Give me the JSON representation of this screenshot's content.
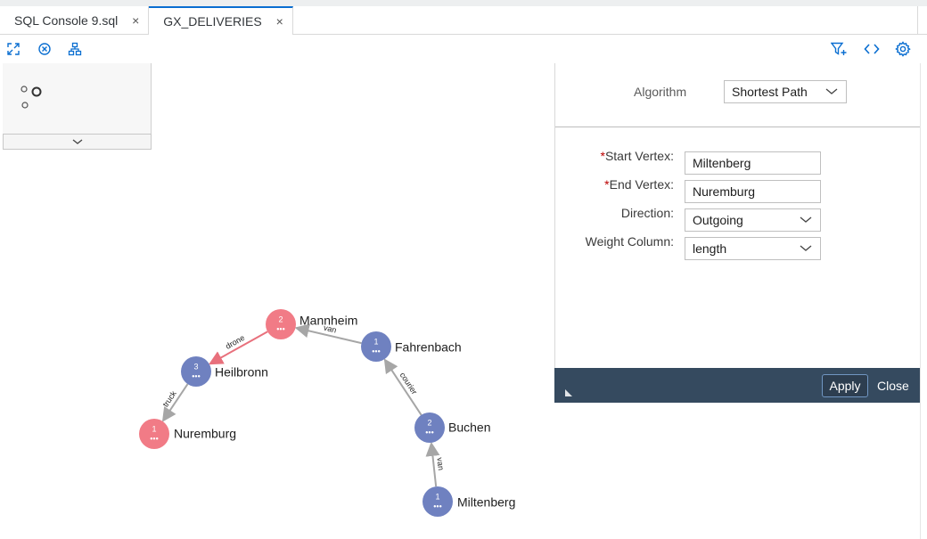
{
  "tabs": [
    {
      "label": "SQL Console 9.sql",
      "close": "×",
      "active": false
    },
    {
      "label": "GX_DELIVERIES",
      "close": "×",
      "active": true
    }
  ],
  "toolbar": {
    "left_icons": [
      "expand-icon",
      "clear-icon",
      "hierarchy-icon"
    ],
    "right_icons": [
      "filter-add-icon",
      "code-icon",
      "settings-icon"
    ]
  },
  "graph": {
    "vertices": [
      {
        "name": "Mannheim",
        "count": "2",
        "color": "#f17b86",
        "highlighted": true
      },
      {
        "name": "Fahrenbach",
        "count": "1",
        "color": "#6f81c0",
        "highlighted": false
      },
      {
        "name": "Heilbronn",
        "count": "3",
        "color": "#6f81c0",
        "highlighted": false
      },
      {
        "name": "Nuremburg",
        "count": "1",
        "color": "#f17b86",
        "highlighted": true
      },
      {
        "name": "Buchen",
        "count": "2",
        "color": "#6f81c0",
        "highlighted": false
      },
      {
        "name": "Miltenberg",
        "count": "1",
        "color": "#6f81c0",
        "highlighted": false
      }
    ],
    "edges": [
      {
        "from": "Fahrenbach",
        "to": "Mannheim",
        "label": "van",
        "highlighted": false
      },
      {
        "from": "Mannheim",
        "to": "Heilbronn",
        "label": "drone",
        "highlighted": true
      },
      {
        "from": "Heilbronn",
        "to": "Nuremburg",
        "label": "truck",
        "highlighted": false
      },
      {
        "from": "Buchen",
        "to": "Fahrenbach",
        "label": "courier",
        "highlighted": false
      },
      {
        "from": "Miltenberg",
        "to": "Buchen",
        "label": "van",
        "highlighted": false
      }
    ],
    "vertex_dots": "•••"
  },
  "panel": {
    "algorithm_label": "Algorithm",
    "algorithm_value": "Shortest Path",
    "start_label": "Start Vertex:",
    "start_value": "Miltenberg",
    "end_label": "End Vertex:",
    "end_value": "Nuremburg",
    "direction_label": "Direction:",
    "direction_value": "Outgoing",
    "weight_label": "Weight Column:",
    "weight_value": "length",
    "required_marker": "*",
    "apply_label": "Apply",
    "close_label": "Close"
  },
  "colors": {
    "accent": "#0a6ed1",
    "highlight_vertex": "#f17b86",
    "normal_vertex": "#6f81c0",
    "highlight_edge": "#e8707c",
    "normal_edge": "#a6a6a6",
    "footer": "#354a5f"
  }
}
